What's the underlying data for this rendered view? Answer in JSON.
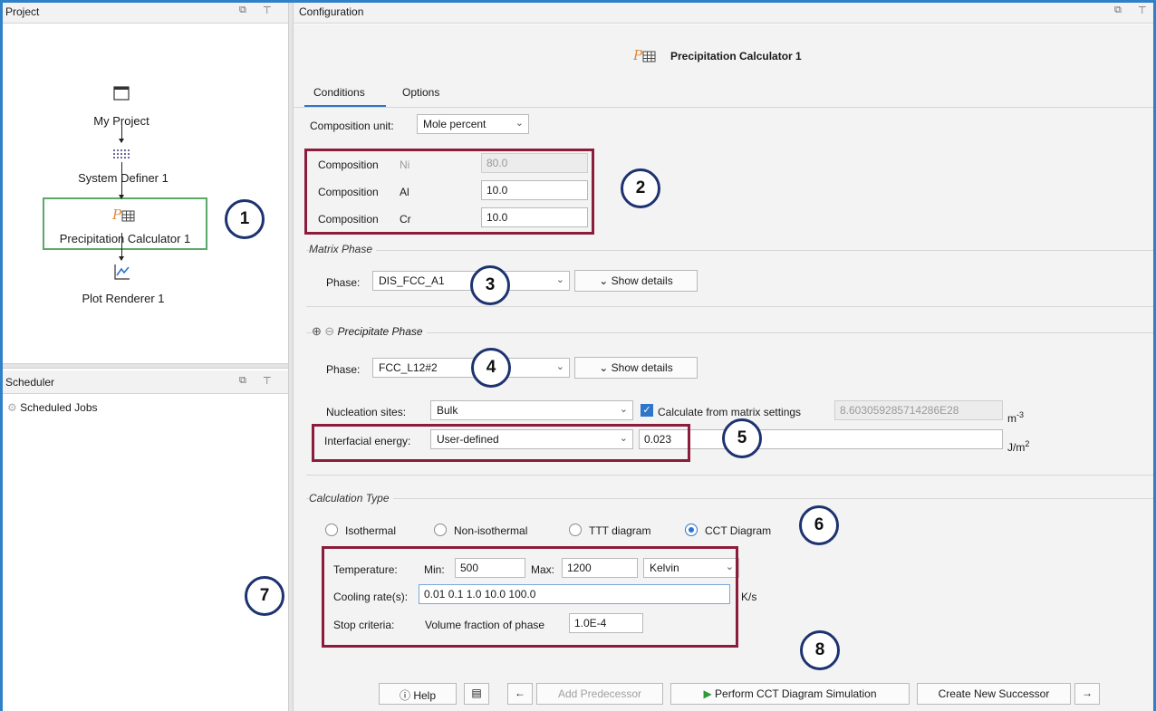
{
  "project_panel": {
    "title": "Project"
  },
  "tree": {
    "nodes": [
      {
        "label": "My Project"
      },
      {
        "label": "System Definer 1"
      },
      {
        "label": "Precipitation Calculator 1"
      },
      {
        "label": "Plot Renderer 1"
      }
    ]
  },
  "scheduler_panel": {
    "title": "Scheduler",
    "item": "Scheduled Jobs"
  },
  "config_panel": {
    "title": "Configuration",
    "heading": "Precipitation Calculator 1"
  },
  "tabs": [
    {
      "label": "Conditions"
    },
    {
      "label": "Options"
    }
  ],
  "composition_unit": {
    "label": "Composition unit:",
    "value": "Mole percent"
  },
  "compositions": [
    {
      "label": "Composition",
      "element": "Ni",
      "value": "80.0"
    },
    {
      "label": "Composition",
      "element": "Al",
      "value": "10.0"
    },
    {
      "label": "Composition",
      "element": "Cr",
      "value": "10.0"
    }
  ],
  "matrix_phase": {
    "title": "Matrix Phase",
    "label": "Phase:",
    "value": "DIS_FCC_A1",
    "details": "Show details"
  },
  "precipitate_phase": {
    "title": "Precipitate Phase",
    "label": "Phase:",
    "value": "FCC_L12#2",
    "details": "Show details",
    "nucleation_label": "Nucleation sites:",
    "nucleation_value": "Bulk",
    "calc_from_matrix": "Calculate from matrix settings",
    "nucleation_density": "8.603059285714286E28",
    "density_unit": "m",
    "density_exp": "-3",
    "interfacial_label": "Interfacial energy:",
    "interfacial_mode": "User-defined",
    "interfacial_value": "0.023",
    "interfacial_unit": "J/m",
    "interfacial_exp": "2"
  },
  "calculation_type": {
    "title": "Calculation Type",
    "options": [
      {
        "label": "Isothermal",
        "selected": false
      },
      {
        "label": "Non-isothermal",
        "selected": false
      },
      {
        "label": "TTT diagram",
        "selected": false
      },
      {
        "label": "CCT Diagram",
        "selected": true
      }
    ]
  },
  "temperature": {
    "label": "Temperature:",
    "min_label": "Min:",
    "min": "500",
    "max_label": "Max:",
    "max": "1200",
    "unit": "Kelvin"
  },
  "cooling": {
    "label": "Cooling rate(s):",
    "value": "0.01 0.1 1.0 10.0 100.0",
    "unit": "K/s"
  },
  "stop_criteria": {
    "label": "Stop criteria:",
    "type": "Volume fraction of phase",
    "value": "1.0E-4"
  },
  "toolbar": {
    "help": "Help",
    "add_predecessor": "Add Predecessor",
    "perform": "Perform CCT Diagram Simulation",
    "create_successor": "Create New Successor",
    "back_arrow": "←",
    "forward_arrow": "→"
  },
  "callouts": [
    "1",
    "2",
    "3",
    "4",
    "5",
    "6",
    "7",
    "8"
  ],
  "colors": {
    "accent": "#2e76c9",
    "highlight_box": "#8c1c3c",
    "callout_border": "#1d3270",
    "selection_green": "#5aa86a"
  }
}
